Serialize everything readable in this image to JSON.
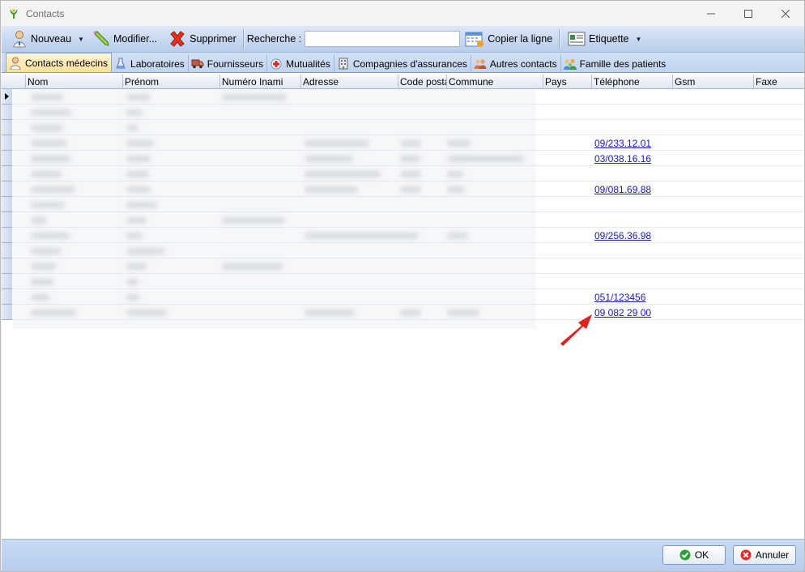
{
  "window": {
    "title": "Contacts",
    "controls": [
      "minimize",
      "maximize",
      "close"
    ]
  },
  "toolbar": {
    "nouveau_label": "Nouveau",
    "modifier_label": "Modifier...",
    "supprimer_label": "Supprimer",
    "recherche_label": "Recherche :",
    "search_value": "",
    "copier_label": "Copier la ligne",
    "etiquette_label": "Etiquette"
  },
  "tabs": [
    {
      "label": "Contacts médecins",
      "icon": "doctor-icon",
      "active": true
    },
    {
      "label": "Laboratoires",
      "icon": "flask-icon",
      "active": false
    },
    {
      "label": "Fournisseurs",
      "icon": "truck-icon",
      "active": false
    },
    {
      "label": "Mutualités",
      "icon": "medical-cross-icon",
      "active": false
    },
    {
      "label": "Compagnies d'assurances",
      "icon": "building-icon",
      "active": false
    },
    {
      "label": "Autres contacts",
      "icon": "people-icon",
      "active": false
    },
    {
      "label": "Famille des patients",
      "icon": "family-icon",
      "active": false
    }
  ],
  "grid": {
    "columns": [
      "Nom",
      "Prénom",
      "Numéro Inami",
      "Adresse",
      "Code posta",
      "Commune",
      "Pays",
      "Téléphone",
      "Gsm",
      "Faxe"
    ],
    "rows": [
      {
        "telephone": ""
      },
      {
        "telephone": ""
      },
      {
        "telephone": ""
      },
      {
        "telephone": "09/233.12.01"
      },
      {
        "telephone": "03/038.16.16"
      },
      {
        "telephone": ""
      },
      {
        "telephone": "09/081.69.88"
      },
      {
        "telephone": ""
      },
      {
        "telephone": ""
      },
      {
        "telephone": "09/256.36.98"
      },
      {
        "telephone": ""
      },
      {
        "telephone": ""
      },
      {
        "telephone": ""
      },
      {
        "telephone": "051/123456"
      },
      {
        "telephone": "09 082 29 00"
      }
    ]
  },
  "footer": {
    "ok_label": "OK",
    "annuler_label": "Annuler"
  },
  "colors": {
    "annotation_arrow": "#e0201b",
    "link": "#1a1ab5",
    "active_tab": "#ffe09a"
  }
}
